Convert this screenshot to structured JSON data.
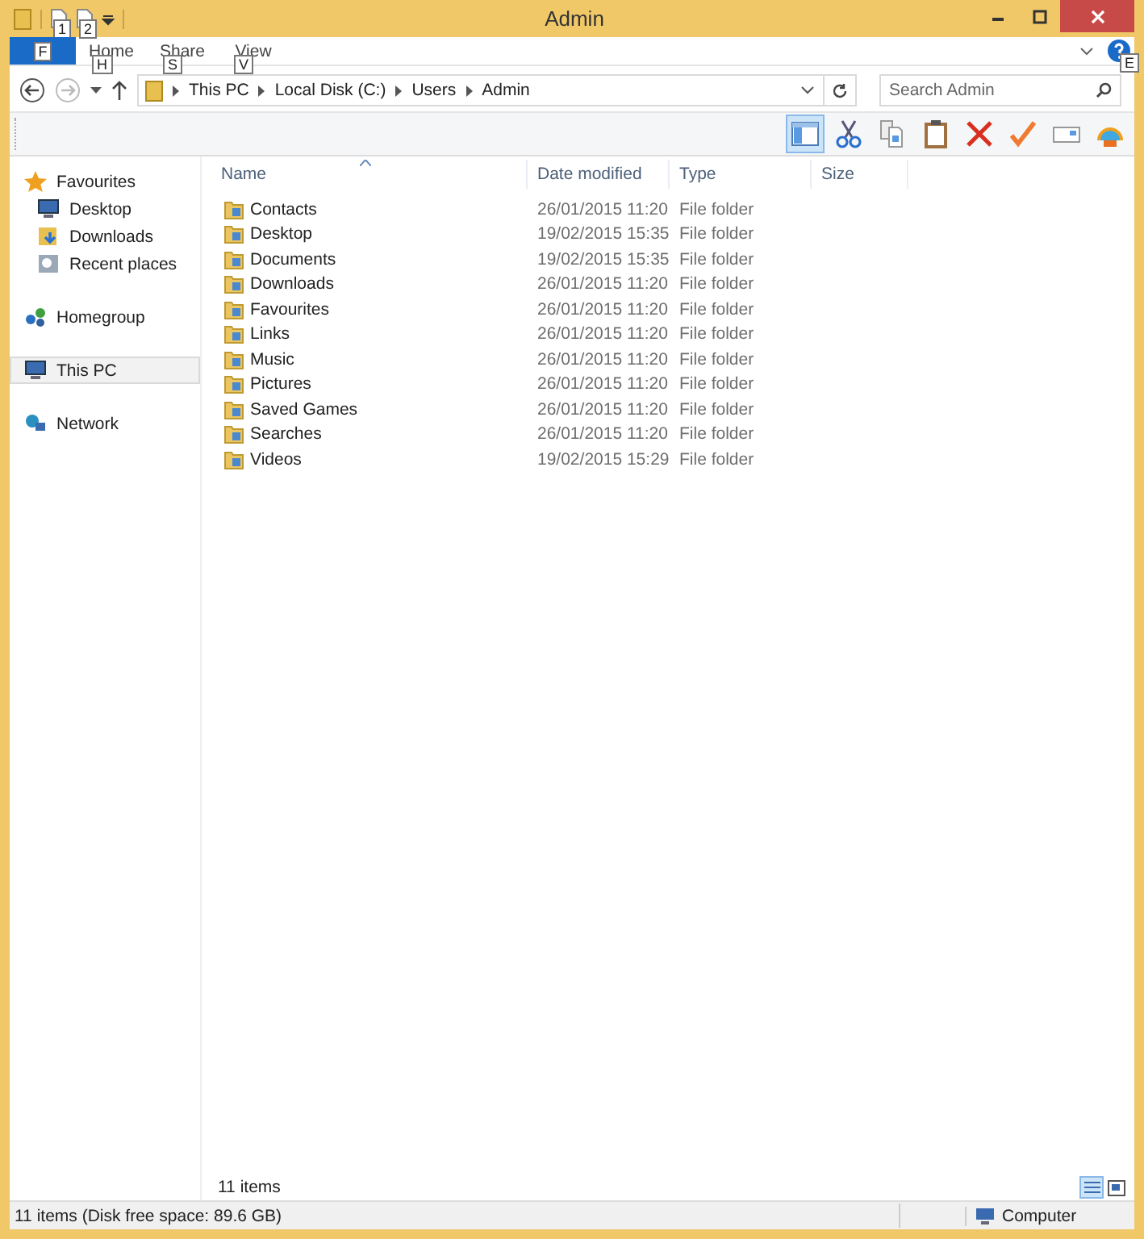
{
  "window": {
    "title": "Admin"
  },
  "quick_access": [
    {
      "keytip": "1"
    },
    {
      "keytip": "2"
    }
  ],
  "ribbon": {
    "tabs": [
      {
        "label": "F",
        "kind": "file",
        "selected": true
      },
      {
        "label": "Home",
        "kind": "tab",
        "keytip": "H",
        "selected": false
      },
      {
        "label": "Share",
        "kind": "tab",
        "keytip": "S",
        "selected": false
      },
      {
        "label": "View",
        "kind": "tab",
        "keytip": "V",
        "selected": false
      }
    ],
    "help_keytip": "E"
  },
  "address": {
    "path": [
      "This PC",
      "Local Disk (C:)",
      "Users",
      "Admin"
    ]
  },
  "search": {
    "placeholder": "Search Admin"
  },
  "preview_pane": {
    "on": true
  },
  "toolbar": [
    {
      "kind": "cut"
    },
    {
      "kind": "copy"
    },
    {
      "kind": "paste"
    },
    {
      "kind": "delete"
    },
    {
      "kind": "check"
    },
    {
      "kind": "rename"
    },
    {
      "kind": "shell"
    }
  ],
  "sidebar": [
    {
      "label": "Favourites",
      "kind": "star",
      "selected": false,
      "children": [
        {
          "label": "Desktop",
          "kind": "desktop",
          "selected": false
        },
        {
          "label": "Downloads",
          "kind": "downloads",
          "selected": false
        },
        {
          "label": "Recent places",
          "kind": "recent",
          "selected": false
        }
      ]
    },
    {
      "label": "Homegroup",
      "kind": "homegroup",
      "selected": false
    },
    {
      "label": "This PC",
      "kind": "pc",
      "selected": true
    },
    {
      "label": "Network",
      "kind": "network",
      "selected": false
    }
  ],
  "table": {
    "columns": [
      "Name",
      "Date modified",
      "Type",
      "Size"
    ],
    "rows": [
      {
        "name": "Contacts",
        "date": "26/01/2015 11:20",
        "type": "File folder"
      },
      {
        "name": "Desktop",
        "date": "19/02/2015 15:35",
        "type": "File folder"
      },
      {
        "name": "Documents",
        "date": "19/02/2015 15:35",
        "type": "File folder"
      },
      {
        "name": "Downloads",
        "date": "26/01/2015 11:20",
        "type": "File folder"
      },
      {
        "name": "Favourites",
        "date": "26/01/2015 11:20",
        "type": "File folder"
      },
      {
        "name": "Links",
        "date": "26/01/2015 11:20",
        "type": "File folder"
      },
      {
        "name": "Music",
        "date": "26/01/2015 11:20",
        "type": "File folder"
      },
      {
        "name": "Pictures",
        "date": "26/01/2015 11:20",
        "type": "File folder"
      },
      {
        "name": "Saved Games",
        "date": "26/01/2015 11:20",
        "type": "File folder"
      },
      {
        "name": "Searches",
        "date": "26/01/2015 11:20",
        "type": "File folder"
      },
      {
        "name": "Videos",
        "date": "19/02/2015 15:29",
        "type": "File folder"
      }
    ]
  },
  "item_count": "11 items",
  "status_bar": {
    "left": "11 items (Disk free space: 89.6 GB)",
    "right": "Computer"
  }
}
